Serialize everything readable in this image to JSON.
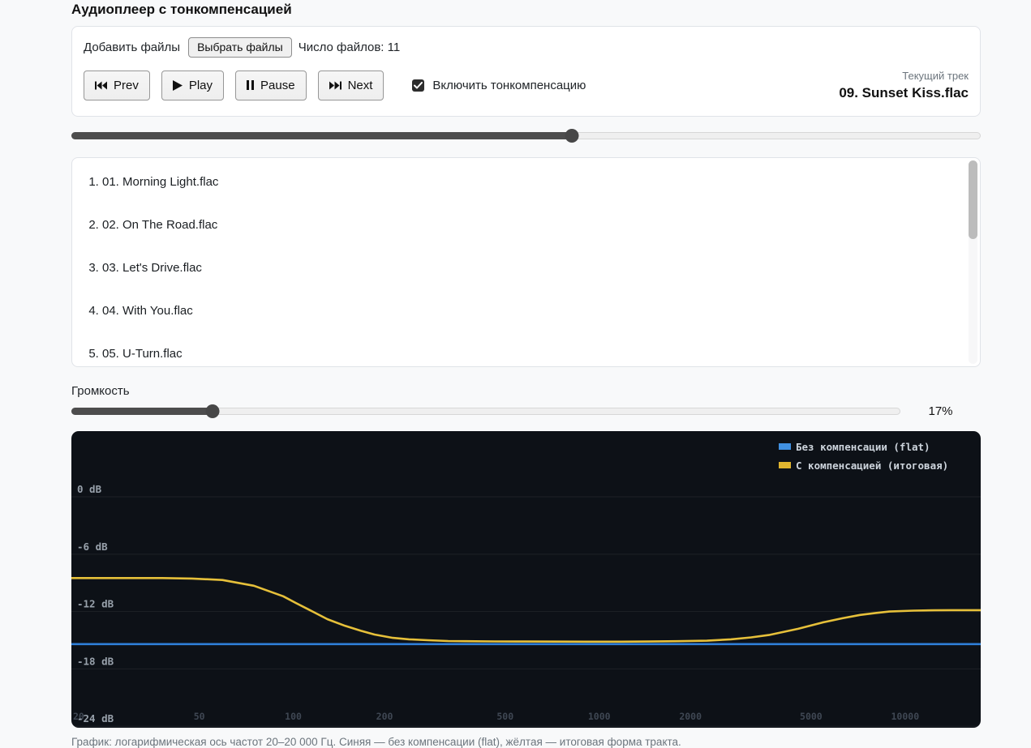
{
  "page": {
    "title": "Аудиоплеер с тонкомпенсацией",
    "footer_caption": "График: логарифмическая ось частот 20–20 000 Гц. Синяя — без компенсации (flat), жёлтая — итоговая форма тракта."
  },
  "file_controls": {
    "label": "Добавить файлы",
    "choose_button_label": "Выбрать файлы",
    "count_label": "Число файлов:",
    "count_value": "11"
  },
  "player": {
    "prev_label": "Prev",
    "play_label": "Play",
    "pause_label": "Pause",
    "next_label": "Next",
    "loudness_checkbox_label": "Включить тонкомпенсацию",
    "loudness_checked": true,
    "current_track_caption": "Текущий трек",
    "current_track_name": "09. Sunset Kiss.flac",
    "progress_percent": 55
  },
  "playlist": {
    "items": [
      "01. Morning Light.flac",
      "02. On The Road.flac",
      "03. Let's Drive.flac",
      "04. With You.flac",
      "05. U-Turn.flac"
    ]
  },
  "volume": {
    "label": "Громкость",
    "percent": 17,
    "percent_label": "17%"
  },
  "chart_data": {
    "type": "line",
    "x_axis": {
      "scale": "log",
      "min": 20,
      "max": 20000,
      "unit": "Hz",
      "tick_values": [
        20,
        50,
        100,
        200,
        500,
        1000,
        2000,
        5000,
        10000
      ]
    },
    "y_axis": {
      "unit": "dB",
      "ticks": [
        0,
        -6,
        -12,
        -18,
        -24
      ],
      "ymax": 6.87,
      "ymin": -24.15,
      "tick_labels": [
        "0 dB",
        "-6 dB",
        "-12 dB",
        "-18 dB",
        "-24 dB"
      ]
    },
    "legend": [
      {
        "label": "Без компенсации (flat)",
        "color": "#4191e1"
      },
      {
        "label": "С компенсацией (итоговая)",
        "color": "#e0b52f"
      }
    ],
    "series": [
      {
        "name": "flat",
        "color": "#2f7fd8",
        "x": [
          20,
          20000
        ],
        "y": [
          -15.4,
          -15.4
        ]
      },
      {
        "name": "compensated",
        "color": "#e6c03a",
        "x": [
          20,
          25,
          32,
          40,
          50,
          63,
          80,
          100,
          110,
          125,
          140,
          160,
          180,
          200,
          230,
          260,
          300,
          350,
          400,
          500,
          630,
          800,
          1000,
          1300,
          1600,
          2000,
          2500,
          3000,
          3500,
          4000,
          5000,
          6000,
          7000,
          8000,
          9000,
          10000,
          12000,
          14000,
          16000,
          20000
        ],
        "y": [
          -8.5,
          -8.5,
          -8.5,
          -8.5,
          -8.55,
          -8.7,
          -9.3,
          -10.4,
          -11.1,
          -12.0,
          -12.8,
          -13.5,
          -14.0,
          -14.4,
          -14.75,
          -14.9,
          -15.0,
          -15.08,
          -15.1,
          -15.12,
          -15.13,
          -15.14,
          -15.15,
          -15.15,
          -15.13,
          -15.1,
          -15.05,
          -14.9,
          -14.7,
          -14.45,
          -13.8,
          -13.15,
          -12.7,
          -12.35,
          -12.15,
          -12.0,
          -11.9,
          -11.87,
          -11.85,
          -11.85
        ]
      }
    ],
    "colors": {
      "background": "#0d1117",
      "grid": "rgba(255,255,255,0.07)",
      "y_label": "#98a1ab",
      "x_label": "#3f4753",
      "legend_text": "#cdd4dc"
    }
  }
}
